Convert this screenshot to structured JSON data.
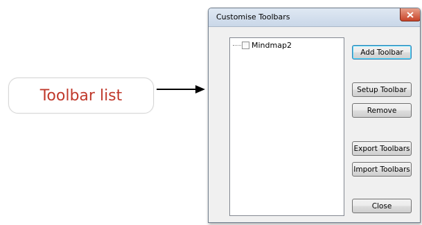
{
  "callout": {
    "label": "Toolbar list"
  },
  "dialog": {
    "title": "Customise Toolbars",
    "close_icon": "close-icon",
    "tree": {
      "items": [
        {
          "label": "Mindmap2",
          "checked": false
        }
      ]
    },
    "buttons": {
      "add_toolbar": "Add Toolbar",
      "setup_toolbar": "Setup Toolbar",
      "remove": "Remove",
      "export_toolbars": "Export Toolbars",
      "import_toolbars": "Import Toolbars",
      "close": "Close"
    }
  },
  "colors": {
    "callout_text": "#c0392b",
    "close_button": "#c8442a"
  }
}
